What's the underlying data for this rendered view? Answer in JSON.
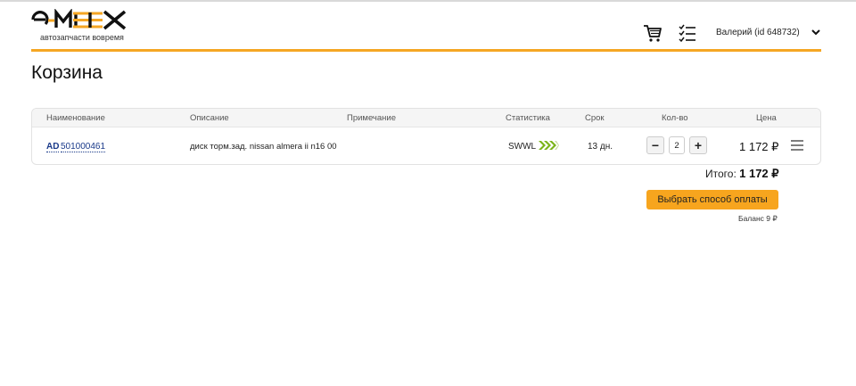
{
  "header": {
    "logo_text": "e-MEX",
    "logo_tagline": "автозапчасти вовремя",
    "user_label": "Валерий  (id 648732)",
    "accent_color": "#f5a623",
    "icons": [
      "cart-icon",
      "task-list-icon",
      "chevron-down-icon"
    ]
  },
  "page": {
    "title": "Корзина"
  },
  "cart": {
    "columns": {
      "name": "Наименование",
      "description": "Описание",
      "note": "Примечание",
      "statistics": "Статистика",
      "term": "Срок",
      "quantity": "Кол-во",
      "price": "Цена"
    },
    "items": [
      {
        "brand": "AD",
        "part_number": "501000461",
        "description": "диск торм.зад. nissan almera ii n16 00",
        "note": "",
        "statistics_code": "SWWL",
        "term": "13 дн.",
        "quantity": "2",
        "price": "1 172 ₽"
      }
    ],
    "total_label": "Итого:",
    "total_value": "1 172 ₽",
    "pay_button": "Выбрать способ оплаты",
    "balance": "Баланс 9 ₽"
  },
  "colors": {
    "brand_orange": "#f7a51e",
    "link_blue": "#1a3a8a",
    "stat_green": "#7ab317"
  }
}
